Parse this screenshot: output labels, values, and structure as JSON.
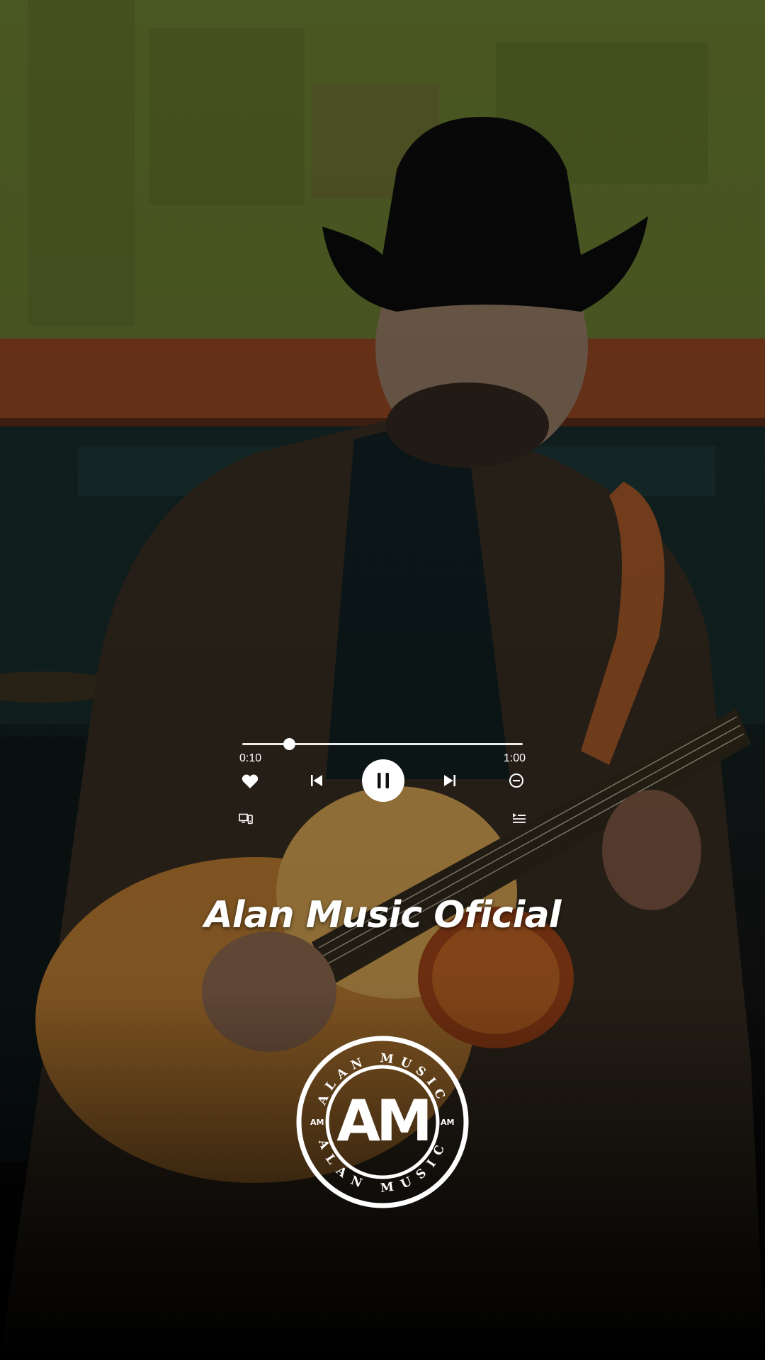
{
  "player": {
    "elapsed": "0:10",
    "total": "1:00",
    "progress_fraction": 0.167,
    "state": "playing"
  },
  "icons": {
    "like": "heart-icon",
    "previous": "skip-previous-icon",
    "play_pause": "pause-icon",
    "next": "skip-next-icon",
    "remove": "minus-circle-icon",
    "device": "device-icon",
    "queue": "queue-icon"
  },
  "overlay": {
    "channel_name": "Alan Music Oficial"
  },
  "logo": {
    "monogram": "AM",
    "ring_text_top": "ALAN MUSIC",
    "ring_text_bottom": "ALAN MUSIC",
    "side_mark": "AM"
  },
  "colors": {
    "control": "#ffffff",
    "background_top": "#5a6a2c",
    "background_bottom": "#000000"
  }
}
